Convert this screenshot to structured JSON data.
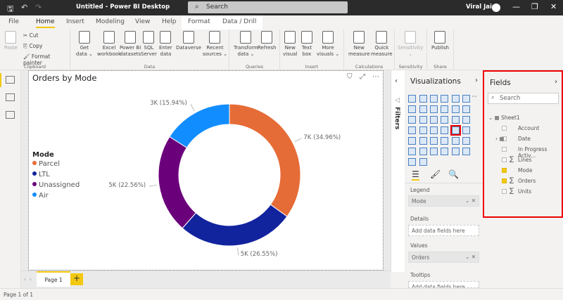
{
  "window": {
    "title": "Untitled - Power BI Desktop",
    "search_placeholder": "Search",
    "user": "Viral Jain"
  },
  "tabs": [
    "File",
    "Home",
    "Insert",
    "Modeling",
    "View",
    "Help",
    "Format",
    "Data / Drill"
  ],
  "ribbon": {
    "clipboard": {
      "paste": "Paste",
      "cut": "Cut",
      "copy": "Copy",
      "format_painter": "Format painter",
      "label": "Clipboard"
    },
    "data": {
      "label": "Data",
      "buttons": [
        "Get\ndata ⌄",
        "Excel\nworkbook",
        "Power BI\ndatasets",
        "SQL\nServer",
        "Enter\ndata",
        "Dataverse",
        "Recent\nsources ⌄"
      ]
    },
    "queries": {
      "label": "Queries",
      "buttons": [
        "Transform\ndata ⌄",
        "Refresh"
      ]
    },
    "insert": {
      "label": "Insert",
      "buttons": [
        "New\nvisual",
        "Text\nbox",
        "More\nvisuals ⌄"
      ]
    },
    "calculations": {
      "label": "Calculations",
      "buttons": [
        "New\nmeasure",
        "Quick\nmeasure"
      ]
    },
    "sensitivity": {
      "label": "Sensitivity",
      "buttons": [
        "Sensitivity\n⌄"
      ]
    },
    "share": {
      "label": "Share",
      "buttons": [
        "Publish"
      ]
    }
  },
  "visual": {
    "title": "Orders by Mode",
    "legend_title": "Mode"
  },
  "chart_data": {
    "type": "pie",
    "variant": "donut",
    "title": "Orders by Mode",
    "legend_title": "Mode",
    "legend_placement": "left",
    "categories": [
      "Parcel",
      "LTL",
      "Unassigned",
      "Air"
    ],
    "values": [
      34.96,
      26.55,
      22.56,
      15.94
    ],
    "labels": [
      "7K (34.96%)",
      "5K (26.55%)",
      "5K (22.56%)",
      "3K (15.94%)"
    ],
    "colors": [
      "#E66C37",
      "#12239E",
      "#6B007B",
      "#118DFF"
    ]
  },
  "pages": {
    "tab": "Page 1",
    "add": "+"
  },
  "status": "Page 1 of 1",
  "filters": {
    "label": "Filters"
  },
  "viz": {
    "title": "Visualizations",
    "legend": "Legend",
    "legend_field": "Mode",
    "details": "Details",
    "details_placeholder": "Add data fields here",
    "values": "Values",
    "values_field": "Orders",
    "tooltips": "Tooltips",
    "tooltips_placeholder": "Add data fields here"
  },
  "fields": {
    "title": "Fields",
    "search_placeholder": "Search",
    "table": "Sheet1",
    "items": [
      {
        "name": "Account",
        "checked": false,
        "sigma": false
      },
      {
        "name": "Date",
        "checked": false,
        "sigma": false
      },
      {
        "name": "In Progress Activ...",
        "checked": false,
        "sigma": false
      },
      {
        "name": "Lines",
        "checked": false,
        "sigma": true
      },
      {
        "name": "Mode",
        "checked": true,
        "sigma": false
      },
      {
        "name": "Orders",
        "checked": true,
        "sigma": true
      },
      {
        "name": "Units",
        "checked": false,
        "sigma": true
      }
    ]
  }
}
